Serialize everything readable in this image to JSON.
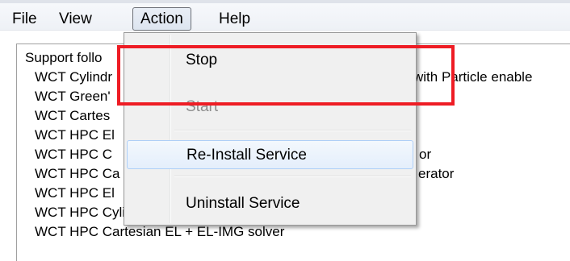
{
  "menubar": {
    "items": [
      "File",
      "View",
      "Action",
      "Help"
    ],
    "active": "Action"
  },
  "panel": {
    "lines": [
      "Support follo",
      "WCT Cylindr",
      "WCT Green'",
      "WCT Cartes",
      "WCT HPC El",
      "WCT HPC C",
      "WCT HPC Ca",
      "WCT HPC El",
      "WCT HPC Cylindrical EL (BHA) solver",
      "WCT HPC Cartesian EL + EL-IMG solver"
    ],
    "right_fragments": {
      "line1": "with Particle enable",
      "line5": "or",
      "line6": "erator"
    }
  },
  "action_menu": {
    "items": [
      {
        "label": "Stop",
        "enabled": true
      },
      {
        "label": "Start",
        "enabled": false
      },
      {
        "label": "Re-Install Service",
        "enabled": true,
        "hover": true
      },
      {
        "label": "Uninstall Service",
        "enabled": true
      }
    ]
  },
  "colors": {
    "highlight": "#ee1c24",
    "hover_fill": "#e4eefb",
    "hover_border": "#aecff7",
    "disabled_text": "#8c8c8c"
  }
}
